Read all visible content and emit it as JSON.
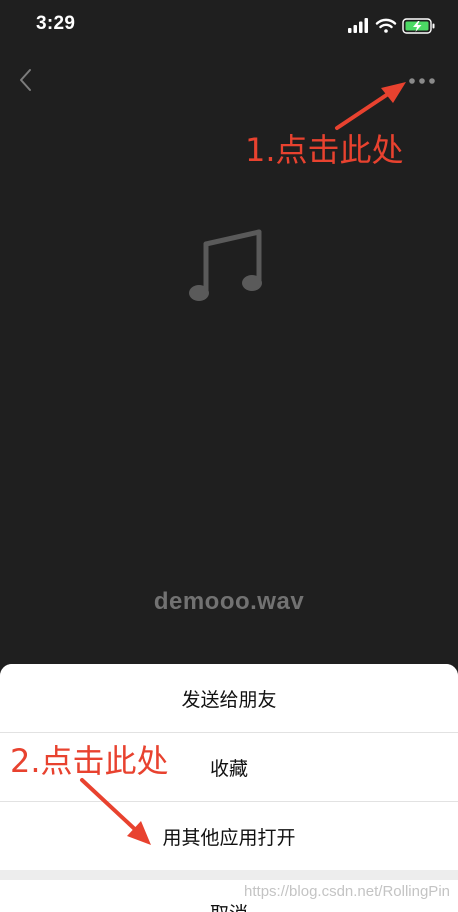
{
  "status_bar": {
    "time": "3:29",
    "icons": [
      "signal-icon",
      "wifi-icon",
      "battery-icon"
    ]
  },
  "nav": {
    "back_icon": "chevron-left-icon",
    "more_icon": "more-dots-icon"
  },
  "file": {
    "icon": "music-note-icon",
    "name": "demooo.wav"
  },
  "action_sheet": {
    "items": [
      "发送给朋友",
      "收藏",
      "用其他应用打开"
    ],
    "cancel_label": "取消"
  },
  "annotations": {
    "step1": "1.点击此处",
    "step2": "2.点击此处"
  },
  "watermark": "https://blog.csdn.net/RollingPin",
  "colors": {
    "background": "#1f1f1f",
    "annotation": "#e8422f",
    "battery": "#4cd964"
  }
}
